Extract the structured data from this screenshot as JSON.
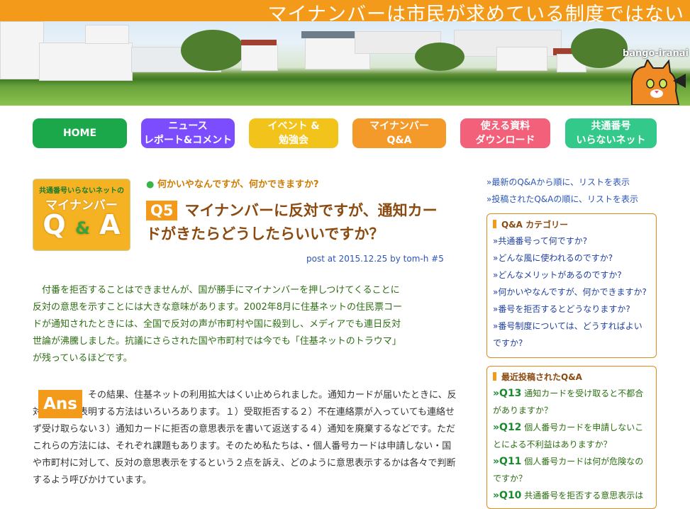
{
  "banner": {
    "title": "マイナンバーは市民が求めている制度ではない",
    "logo": "bango-iranai"
  },
  "nav": [
    {
      "label": "HOME",
      "color": "#1aa84a"
    },
    {
      "label": "ニュース\nレポート&コメント",
      "color": "#7c4dff"
    },
    {
      "label": "イベント &\n勉強会",
      "color": "#f2c31a"
    },
    {
      "label": "マイナンバー\nQ&A",
      "color": "#f39a2a"
    },
    {
      "label": "使える資料\nダウンロード",
      "color": "#f2607a"
    },
    {
      "label": "共通番号\nいらないネット",
      "color": "#33c98a"
    }
  ],
  "badge": {
    "line1": "共通番号いらないネットの",
    "line2": "マイナンバー",
    "q": "Q",
    "amp": "&",
    "a": "A"
  },
  "article": {
    "category": "何かいやなんですが、何かできますか?",
    "q_label": "Q5",
    "title": "マイナンバーに反対ですが、通知カードがきたらどうしたらいいですか？",
    "meta": "post at 2015.12.25 by tom-h #5",
    "lead": "　付番を拒否することはできませんが、国が勝手にマイナンバーを押しつけてくることに反対の意思を示すことには大きな意味があります。2002年8月に住基ネットの住民票コードが通知されたときには、全国で反対の声が市町村や国に殺到し、メディアでも連日反対世論が沸騰しました。抗議にさらされた国や市町村では今でも「住基ネットのトラウマ」が残っているほどです。",
    "ans_label": "Ans",
    "answer": "その結果、住基ネットの利用拡大はくい止められました。通知カードが届いたときに、反対の意思を表明する方法はいろいろあります。１）受取拒否する２）不在連絡票が入っていても連絡せず受け取らない３）通知カードに拒否の意思表示を書いて返送する４）通知を廃棄するなどです。ただこれらの方法には、それぞれ課題もあります。そのため私たちは、・個人番号カードは申請しない・国や市町村に対して、反対の意思表示をするという２点を訴え、どのように意思表示するかは各々で判断するよう呼びかけています。"
  },
  "sidebar": {
    "links": [
      "»最新のQ&Aから順に、リストを表示",
      "»投稿されたQ&Aの順に、リストを表示"
    ],
    "categories_title": "Q&A カテゴリー",
    "categories": [
      "»共通番号って何ですか?",
      "»どんな風に使われるのですか?",
      "»どんなメリットがあるのですか?",
      "»何かいやなんですが、何かできますか?",
      "»番号を拒否するとどうなりますか?",
      "»番号制度については、どうすればよいですか?"
    ],
    "recent_title": "最近投稿されたQ&A",
    "recent": [
      {
        "num": "»Q13",
        "text": "通知カードを受け取ると不都合がありますか？"
      },
      {
        "num": "»Q12",
        "text": "個人番号カードを申請しないことによる不利益はありますか？"
      },
      {
        "num": "»Q11",
        "text": "個人番号カードは何が危険なのですか？"
      },
      {
        "num": "»Q10",
        "text": "共通番号を拒否する意思表示は"
      }
    ]
  }
}
